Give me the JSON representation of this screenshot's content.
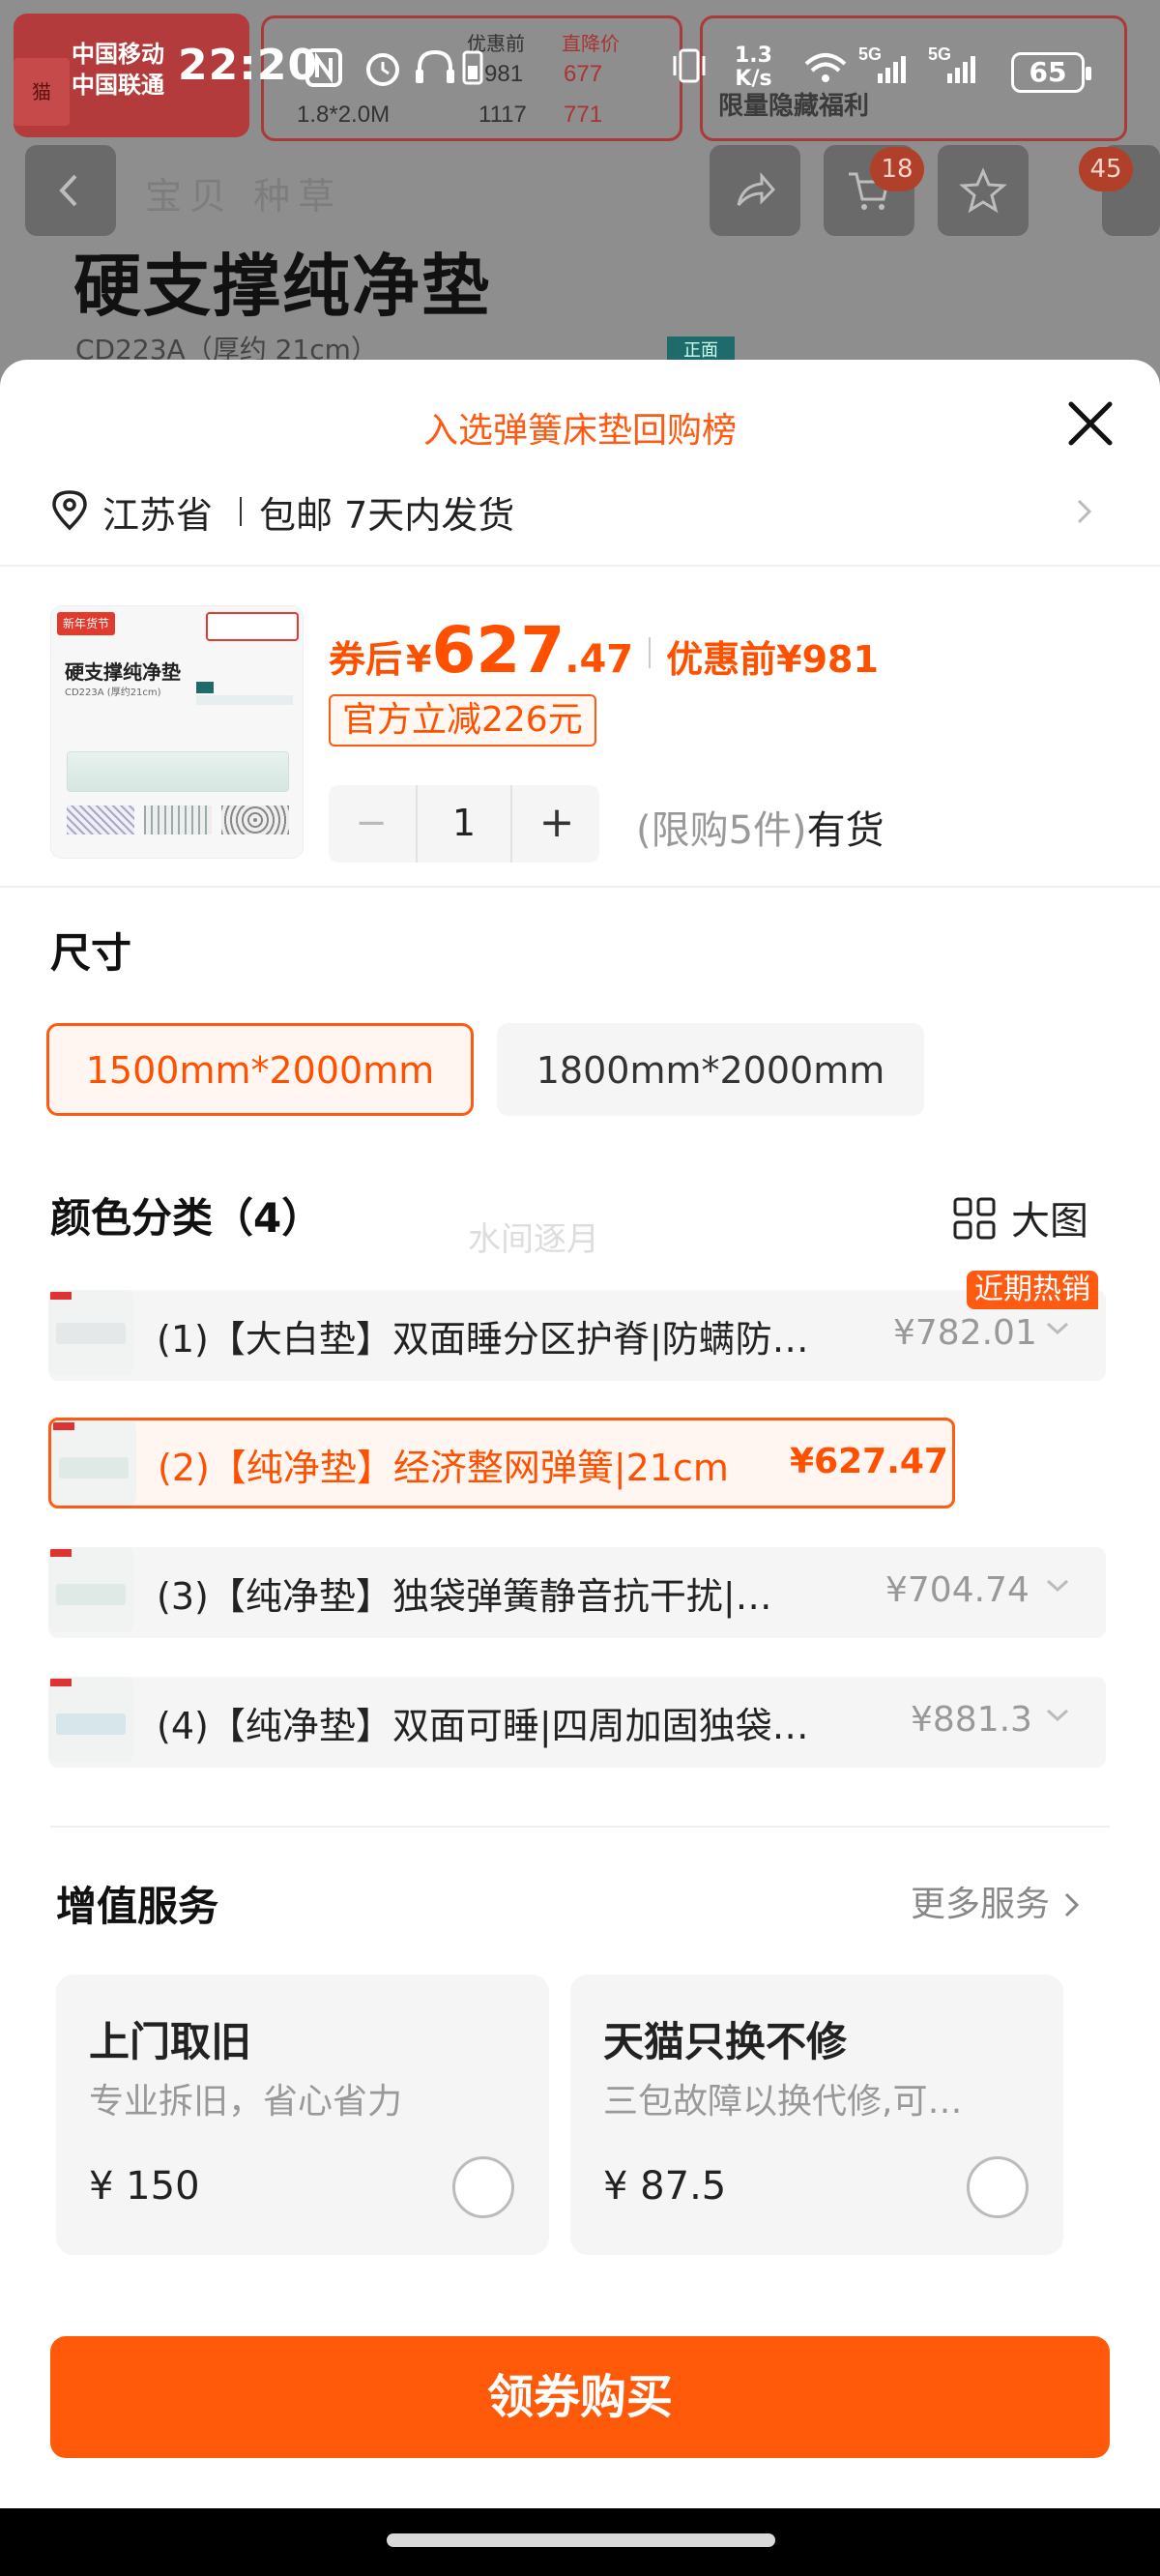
{
  "status_bar": {
    "carrier_1": "中国移动",
    "carrier_2": "中国联通",
    "time": "22:20",
    "net_speed_value": "1.3",
    "net_speed_unit": "K/s",
    "battery": "65"
  },
  "background_page": {
    "table_header_1": "优惠前",
    "table_header_2": "直降价",
    "row_1_price": "981",
    "row_1_discount": "677",
    "row_2_size": "1.8*2.0M",
    "row_2_price": "1117",
    "row_2_discount": "771",
    "coupon_text": "限量隐藏福利",
    "tabs": "宝贝 种草",
    "cart_badge": "18",
    "more_badge": "45",
    "product_title": "硬支撑纯净垫",
    "product_subtitle": "CD223A（厚约 21cm）",
    "tag": "正面"
  },
  "sheet": {
    "ranking_text": "入选弹簧床垫回购榜",
    "location": "江苏省",
    "shipping": "包邮 7天内发货"
  },
  "product": {
    "thumb_title": "硬支撑纯净垫",
    "thumb_sub": "CD223A (厚约21cm)",
    "thumb_banner": "新年货节",
    "price_label": "券后",
    "currency": "¥",
    "price_int": "627",
    "price_dec": ".47",
    "orig_label": "优惠前",
    "orig_price": "¥981",
    "discount_tag": "官方立减226元",
    "quantity": "1",
    "minus": "−",
    "plus": "+",
    "limit_text": "(限购5件)",
    "stock_text": "有货"
  },
  "size": {
    "heading": "尺寸",
    "options": [
      "1500mm*2000mm",
      "1800mm*2000mm"
    ],
    "selected_index": 0
  },
  "color": {
    "heading": "颜色分类（4）",
    "big_view_label": "大图",
    "watermark": "水间逐月",
    "hot_badge": "近期热销",
    "items": [
      {
        "label": "(1)【大白垫】双面睡分区护脊|防螨防…",
        "price": "¥782.01"
      },
      {
        "label": "(2)【纯净垫】经济整网弹簧|21cm",
        "price": "¥627.47"
      },
      {
        "label": "(3)【纯净垫】独袋弹簧静音抗干扰|…",
        "price": "¥704.74"
      },
      {
        "label": "(4)【纯净垫】双面可睡|四周加固独袋…",
        "price": "¥881.3"
      }
    ],
    "selected_index": 1
  },
  "services": {
    "heading": "增值服务",
    "more_label": "更多服务",
    "items": [
      {
        "title": "上门取旧",
        "desc": "专业拆旧，省心省力",
        "price": "¥ 150"
      },
      {
        "title": "天猫只换不修",
        "desc": "三包故障以换代修,可…",
        "price": "¥ 87.5"
      }
    ]
  },
  "buy_button": "领券购买",
  "colors": {
    "accent": "#ff5a0a",
    "price": "#ff5000"
  }
}
